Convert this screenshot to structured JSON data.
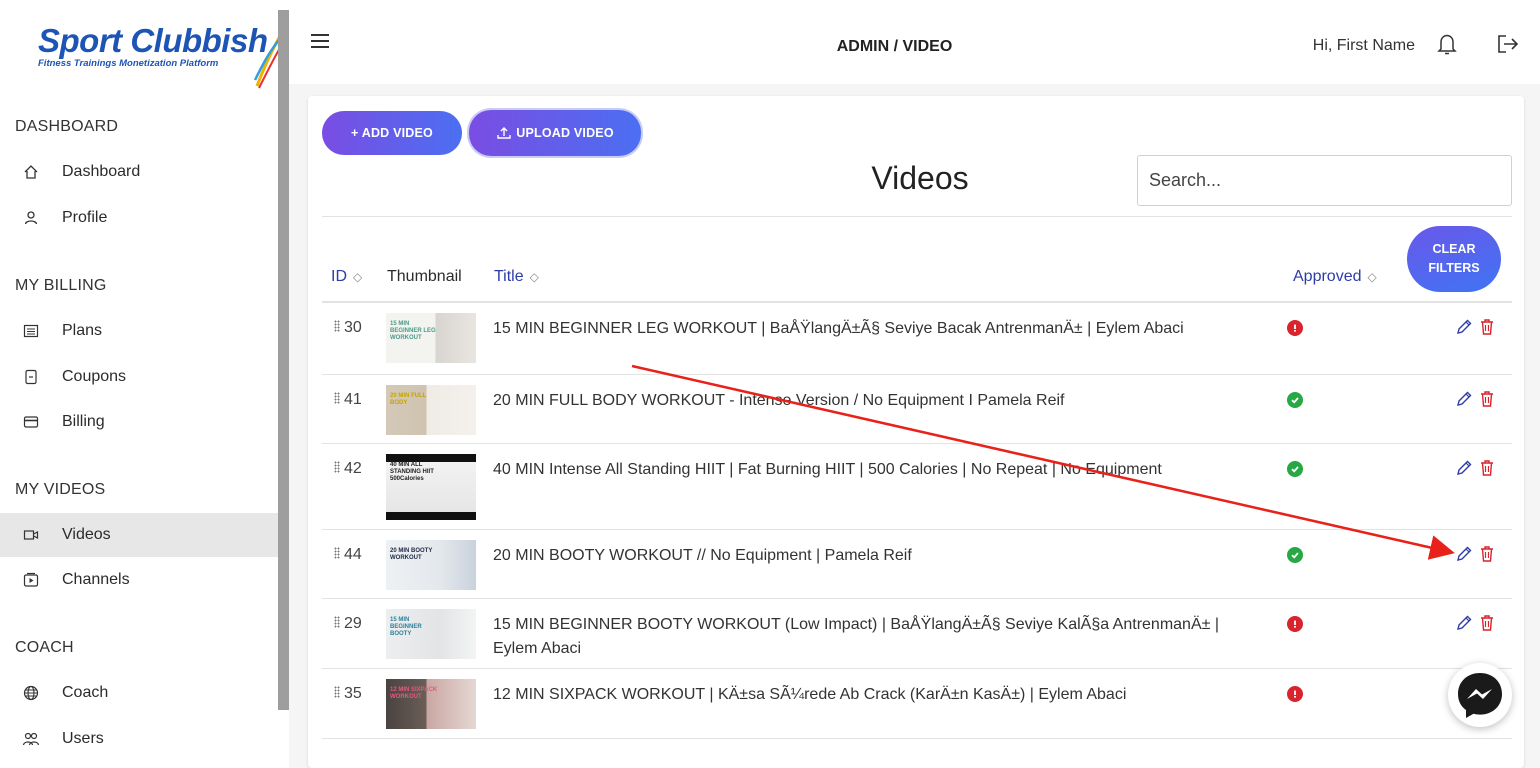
{
  "brand": {
    "name": "Sport Clubbish",
    "tagline": "Fitness Trainings Monetization Platform"
  },
  "topbar": {
    "title": "ADMIN / VIDEO",
    "greeting": "Hi, First Name"
  },
  "sidebar": {
    "sections": [
      {
        "title": "DASHBOARD",
        "items": [
          {
            "label": "Dashboard",
            "icon": "home-icon"
          },
          {
            "label": "Profile",
            "icon": "user-icon"
          }
        ]
      },
      {
        "title": "MY BILLING",
        "items": [
          {
            "label": "Plans",
            "icon": "list-icon"
          },
          {
            "label": "Coupons",
            "icon": "coupon-icon"
          },
          {
            "label": "Billing",
            "icon": "card-icon"
          }
        ]
      },
      {
        "title": "MY VIDEOS",
        "items": [
          {
            "label": "Videos",
            "icon": "video-icon",
            "active": true
          },
          {
            "label": "Channels",
            "icon": "channel-icon"
          }
        ]
      },
      {
        "title": "COACH",
        "items": [
          {
            "label": "Coach",
            "icon": "globe-icon"
          },
          {
            "label": "Users",
            "icon": "users-icon"
          }
        ]
      }
    ]
  },
  "main": {
    "add_label": "+ ADD VIDEO",
    "upload_label": "UPLOAD VIDEO",
    "heading": "Videos",
    "search_placeholder": "Search...",
    "clear_line1": "CLEAR",
    "clear_line2": "FILTERS",
    "columns": {
      "id": "ID",
      "thumbnail": "Thumbnail",
      "title": "Title",
      "approved": "Approved"
    },
    "rows": [
      {
        "id": "30",
        "title": "15 MIN BEGINNER LEG WORKOUT | BaÅŸlangÄ±Ã§ Seviye Bacak AntrenmanÄ± | Eylem Abaci",
        "approved": false,
        "thumb_text": "15 MIN BEGINNER LEG WORKOUT"
      },
      {
        "id": "41",
        "title": "20 MIN FULL BODY WORKOUT - Intense Version / No Equipment I Pamela Reif",
        "approved": true,
        "thumb_text": "20 MIN FULL BODY"
      },
      {
        "id": "42",
        "title": "40 MIN Intense All Standing HIIT | Fat Burning HIIT | 500 Calories | No Repeat | No Equipment",
        "approved": true,
        "thumb_text": "40 MIN ALL STANDING HIIT 500Calories"
      },
      {
        "id": "44",
        "title": "20 MIN BOOTY WORKOUT // No Equipment | Pamela Reif",
        "approved": true,
        "thumb_text": "20 MIN BOOTY WORKOUT"
      },
      {
        "id": "29",
        "title": "15 MIN BEGINNER BOOTY WORKOUT (Low Impact) | BaÅŸlangÄ±Ã§ Seviye KalÃ§a AntrenmanÄ± | Eylem Abaci",
        "approved": false,
        "thumb_text": "15 MIN BEGINNER BOOTY"
      },
      {
        "id": "35",
        "title": "12 MIN SIXPACK WORKOUT | KÄ±sa SÃ¼rede Ab Crack (KarÄ±n KasÄ±) | Eylem Abaci",
        "approved": false,
        "thumb_text": "12 MIN SIXPACK WORKOUT"
      }
    ]
  },
  "colors": {
    "accent": "#5b5fe9",
    "approved": "#28a745",
    "rejected": "#d9232d",
    "edit": "#2d3ca8",
    "delete": "#d9232d",
    "annotation_arrow": "#e8221b"
  }
}
